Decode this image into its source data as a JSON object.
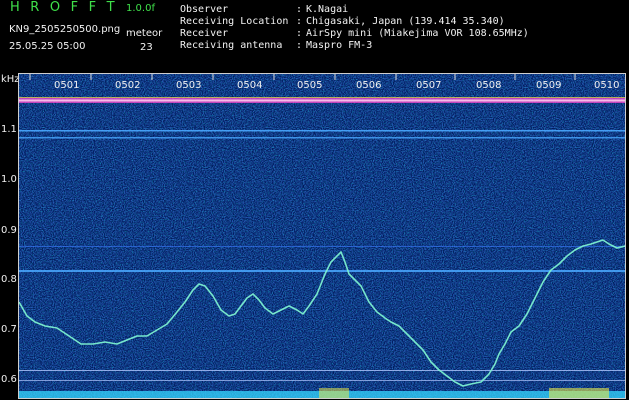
{
  "header": {
    "app_title": "H R O F F T",
    "version": "1.0.0f",
    "filename": "KN9_2505250500.png",
    "meteor_label": "meteor",
    "datetime": "25.05.25 05:00",
    "meteor_count": "23"
  },
  "meta": [
    {
      "label": "Observer",
      "sep": ":",
      "value": "K.Nagai"
    },
    {
      "label": "Receiving Location",
      "sep": ":",
      "value": "Chigasaki, Japan (139.414 35.340)"
    },
    {
      "label": "Receiver",
      "sep": ":",
      "value": "AirSpy mini (Miakejima VOR 108.65MHz)"
    },
    {
      "label": "Receiving antenna",
      "sep": ":",
      "value": "Maspro FM-3"
    }
  ],
  "axis": {
    "unit": "kHz",
    "y_ticks": [
      "1.1",
      "1.0",
      "0.9",
      "0.8",
      "0.7",
      "0.6"
    ],
    "x_ticks": [
      "0501",
      "0502",
      "0503",
      "0504",
      "0505",
      "0506",
      "0507",
      "0508",
      "0509",
      "0510"
    ]
  },
  "colors": {
    "background": "#000000",
    "plot_bg": "#001a5c",
    "title_green": "#3fe04a",
    "trace": "#7cf0d0",
    "carrier": "#ff4ad0",
    "baseline": "#36d8ff"
  }
}
